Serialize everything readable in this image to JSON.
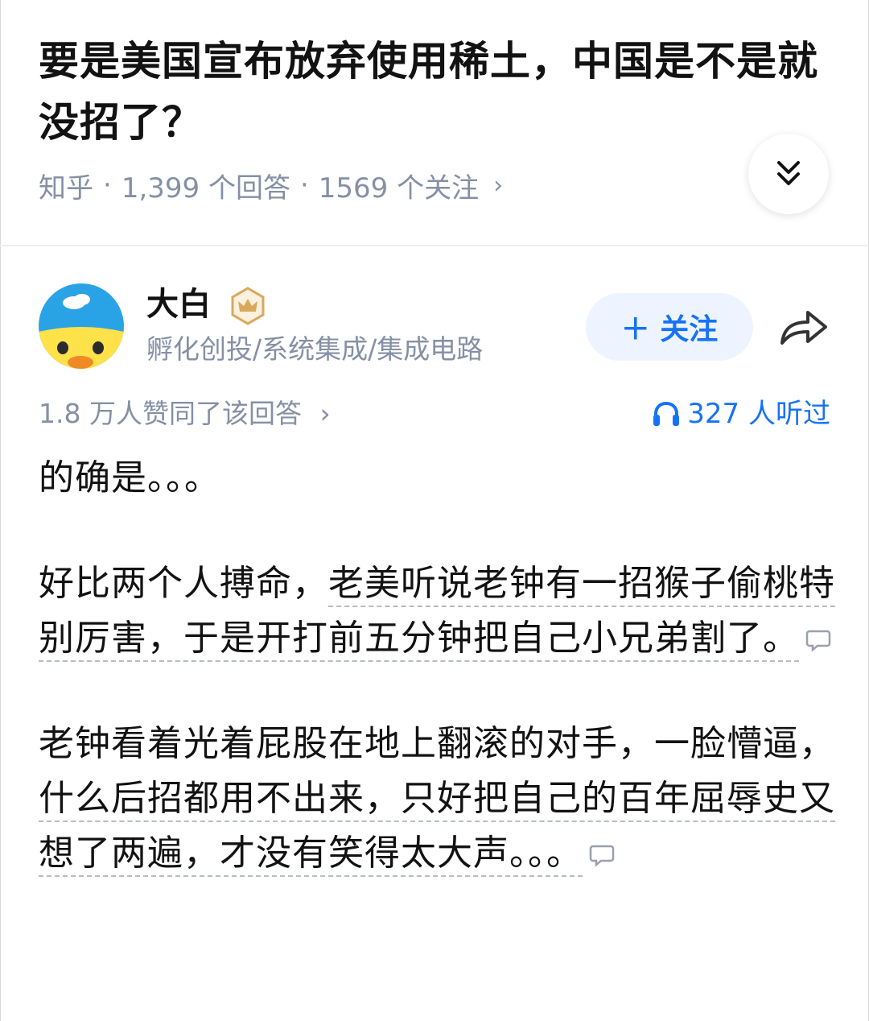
{
  "question": {
    "title": "要是美国宣布放弃使用稀土，中国是不是就没招了？",
    "source": "知乎",
    "answers": "1,399 个回答",
    "follows": "1569 个关注",
    "separator": "·",
    "chevron": "›"
  },
  "icons": {
    "collapse": "double-chevron-down-icon",
    "share": "share-arrow-icon",
    "badge": "crown-badge-icon",
    "headphones": "headphones-icon",
    "comment": "comment-bubble-icon"
  },
  "author": {
    "name": "大白",
    "bio": "孵化创投/系统集成/集成电路",
    "follow_label": "＋ 关注"
  },
  "stats": {
    "upvotes": "1.8 万人赞同了该回答",
    "chevron": "›",
    "listeners": "327 人听过"
  },
  "answer": {
    "p1": "的确是。。。",
    "p2_a": "好比两个人搏命，",
    "p2_b": "老美听说老钟有一招猴子偷桃特别厉害，于是开打前五分钟把自己小兄弟割了。",
    "p3_a": "老钟看着光着屁股在地上翻滚的对手，一脸懵逼，",
    "p3_b": "什么后招都用不出来，只好把自己的百年屈辱史又想了两遍，才没有笑得太大声。。。"
  },
  "colors": {
    "accent": "#1772f6",
    "muted": "#8590a6",
    "follow_bg": "#eef4ff"
  }
}
